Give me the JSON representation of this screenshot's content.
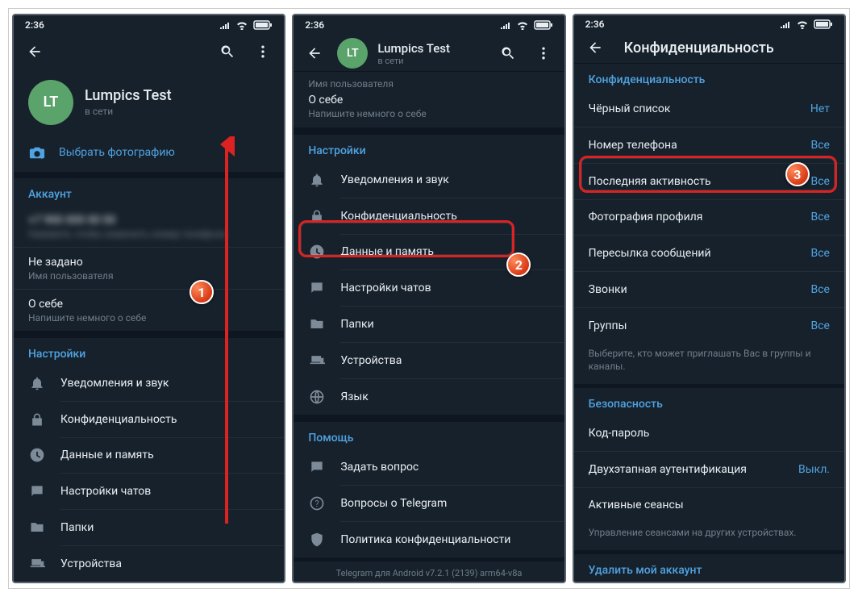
{
  "status": {
    "time": "2:36"
  },
  "badges": {
    "step1": "1",
    "step2": "2",
    "step3": "3"
  },
  "s1": {
    "avatar_initials": "LT",
    "profile_name": "Lumpics Test",
    "profile_status": "в сети",
    "choose_photo": "Выбрать фотографию",
    "account_title": "Аккаунт",
    "acct_line1": "",
    "acct_line2": "",
    "username_val": "Не задано",
    "username_lbl": "Имя пользователя",
    "about_val": "О себе",
    "about_lbl": "Напишите немного о себе",
    "settings_title": "Настройки",
    "notif": "Уведомления и звук",
    "privacy": "Конфиденциальность",
    "data": "Данные и память",
    "chats": "Настройки чатов",
    "folders": "Папки",
    "devices": "Устройства"
  },
  "s2": {
    "avatar_initials": "LT",
    "profile_name": "Lumpics Test",
    "profile_status": "в сети",
    "username_lbl": "Имя пользователя",
    "about_val": "О себе",
    "about_lbl": "Напишите немного о себе",
    "settings_title": "Настройки",
    "notif": "Уведомления и звук",
    "privacy": "Конфиденциальность",
    "data": "Данные и память",
    "chats": "Настройки чатов",
    "folders": "Папки",
    "devices": "Устройства",
    "lang": "Язык",
    "help_title": "Помощь",
    "ask": "Задать вопрос",
    "faq": "Вопросы о Telegram",
    "policy": "Политика конфиденциальности",
    "footer": "Telegram для Android v7.2.1 (2139) arm64-v8a"
  },
  "s3": {
    "title": "Конфиденциальность",
    "sec_privacy": "Конфиденциальность",
    "blacklist_lbl": "Чёрный список",
    "blacklist_val": "Нет",
    "phone_lbl": "Номер телефона",
    "phone_val": "Все",
    "lastseen_lbl": "Последняя активность",
    "lastseen_val": "Все",
    "photo_lbl": "Фотография профиля",
    "photo_val": "Все",
    "forward_lbl": "Пересылка сообщений",
    "forward_val": "Все",
    "calls_lbl": "Звонки",
    "calls_val": "Все",
    "groups_lbl": "Группы",
    "groups_val": "Все",
    "groups_note": "Выберите, кто может приглашать Вас в группы и каналы.",
    "sec_security": "Безопасность",
    "passcode": "Код-пароль",
    "twofa_lbl": "Двухэтапная аутентификация",
    "twofa_val": "Выкл.",
    "sessions": "Активные сеансы",
    "sessions_note": "Управление сеансами на других устройствах.",
    "delete": "Удалить мой аккаунт"
  }
}
